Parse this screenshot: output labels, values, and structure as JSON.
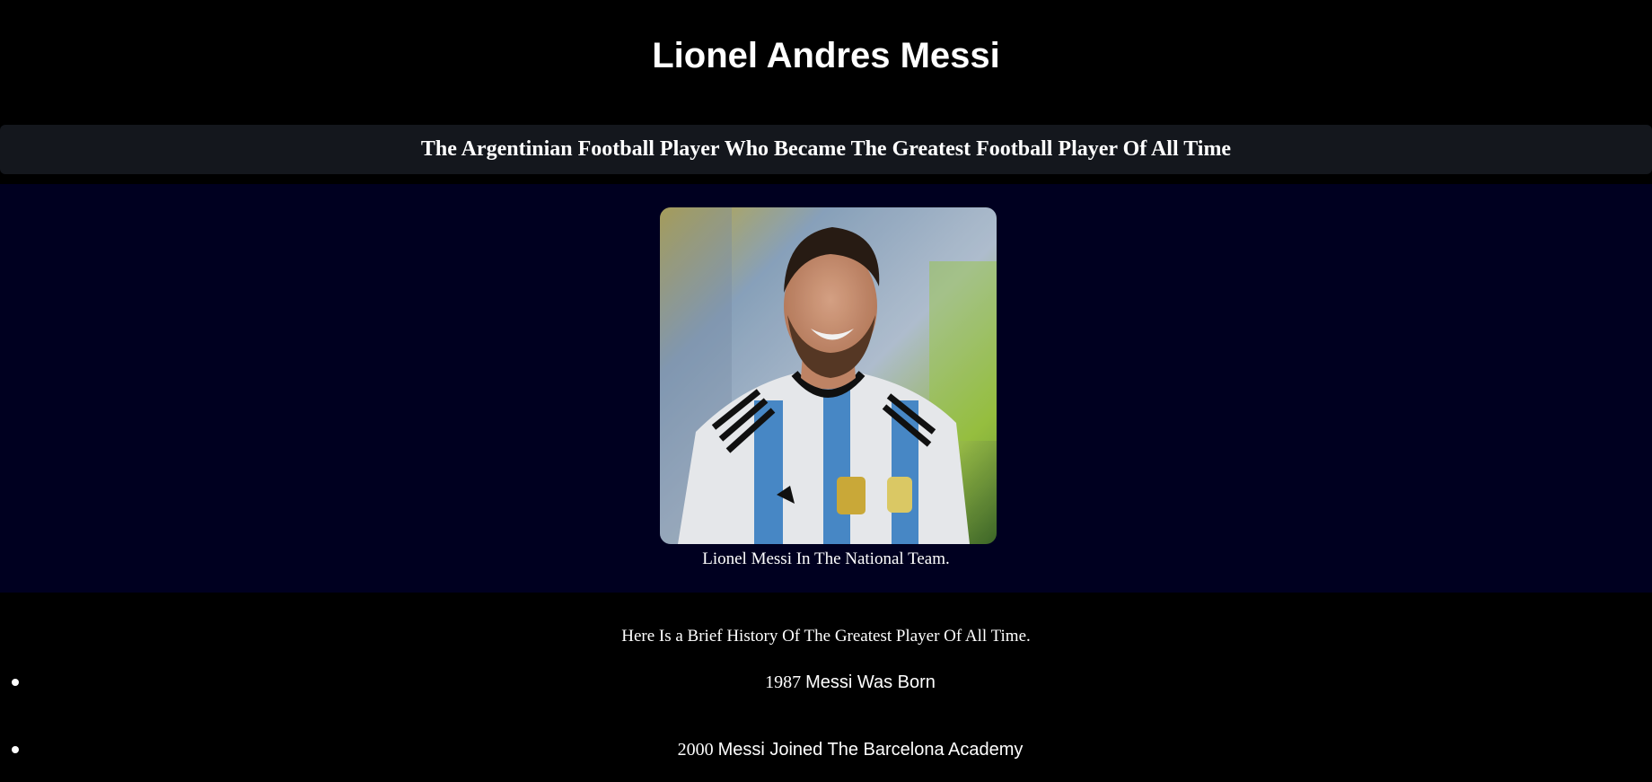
{
  "header": {
    "title": "Lionel Andres Messi",
    "subtitle": "The Argentinian Football Player Who Became The Greatest Football Player Of All Time"
  },
  "hero": {
    "image_subject": "Lionel Messi smiling in Argentina national team jersey",
    "caption": "Lionel Messi In The National Team."
  },
  "history": {
    "intro": "Here Is a Brief History Of The Greatest Player Of All Time.",
    "items": [
      {
        "year": "1987",
        "event": "Messi Was Born"
      },
      {
        "year": "2000",
        "event": "Messi Joined The Barcelona Academy"
      }
    ]
  },
  "colors": {
    "page_background": "#000000",
    "subtitle_bar": "#14171d",
    "hero_background": "#000020",
    "text": "#ffffff"
  }
}
